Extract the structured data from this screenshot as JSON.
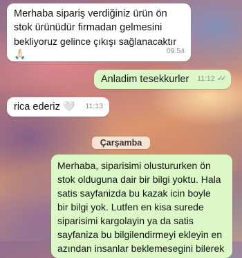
{
  "messages": [
    {
      "direction": "incoming",
      "lines": [
        "Merhaba sipariş verdiğiniz ürün ön",
        "stok ürünüdür firmadan gelmesini",
        "bekliyoruz gelince çıkışı sağlanacaktır",
        "🙏🏻"
      ],
      "time": "09:54"
    },
    {
      "direction": "outgoing",
      "text": "Anladim tesekkurler",
      "time": "11:12",
      "status": "read-ticks"
    },
    {
      "direction": "incoming",
      "text": "rica ederiz 🤍",
      "time": "11:13"
    },
    {
      "direction": "outgoing",
      "lines": [
        "Merhaba, siparisimi olustururken ön",
        "stok olduguna dair bir bilgi yoktu. Hala",
        "satis sayfanizda bu kazak icin boyle",
        "bir bilgi yok. Lutfen en kisa surede",
        "siparisimi kargolayin ya da satis",
        "sayfaniza bu bilgilendirmeyi ekleyin en",
        "azından insanlar beklemesegini bilerek"
      ]
    }
  ],
  "date_separator": "Çarşamba",
  "colors": {
    "incoming_bubble": "#ffffff",
    "outgoing_bubble": "#dcf8c6",
    "date_chip": "#fbe3d4",
    "read_ticks": "#7a8aa0"
  }
}
